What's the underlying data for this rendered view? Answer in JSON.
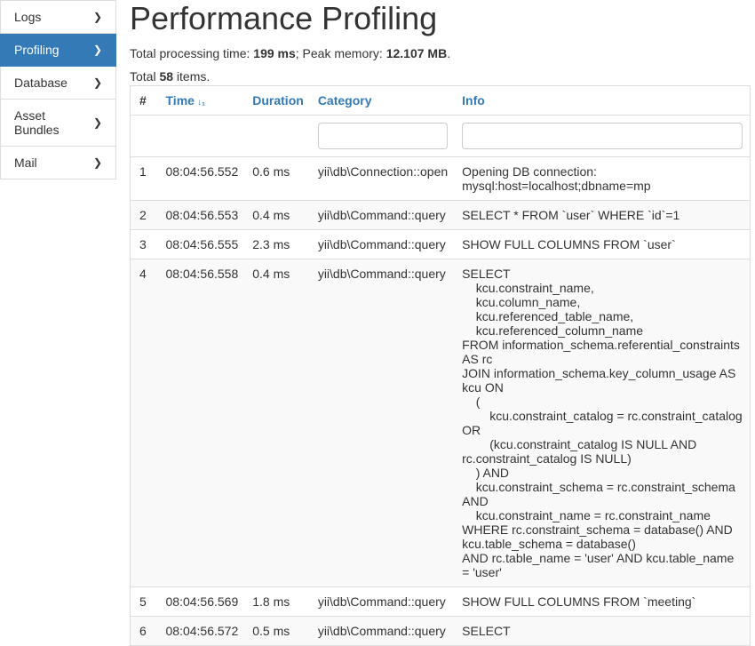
{
  "sidebar": {
    "items": [
      {
        "label": "Logs",
        "active": false
      },
      {
        "label": "Profiling",
        "active": true
      },
      {
        "label": "Database",
        "active": false
      },
      {
        "label": "Asset Bundles",
        "active": false
      },
      {
        "label": "Mail",
        "active": false
      }
    ]
  },
  "header": {
    "title": "Performance Profiling",
    "summary_prefix": "Total processing time: ",
    "processing_time": "199 ms",
    "summary_mid": "; Peak memory: ",
    "peak_memory": "12.107 MB",
    "summary_suffix": ".",
    "total_prefix": "Total ",
    "total_count": "58",
    "total_suffix": " items."
  },
  "table": {
    "headers": {
      "num": "#",
      "time": "Time",
      "duration": "Duration",
      "category": "Category",
      "info": "Info"
    },
    "rows": [
      {
        "num": "1",
        "time": "08:04:56.552",
        "duration": "0.6 ms",
        "category": "yii\\db\\Connection::open",
        "info": "Opening DB connection: mysql:host=localhost;dbname=mp"
      },
      {
        "num": "2",
        "time": "08:04:56.553",
        "duration": "0.4 ms",
        "category": "yii\\db\\Command::query",
        "info": "SELECT * FROM `user` WHERE `id`=1"
      },
      {
        "num": "3",
        "time": "08:04:56.555",
        "duration": "2.3 ms",
        "category": "yii\\db\\Command::query",
        "info": "SHOW FULL COLUMNS FROM `user`"
      },
      {
        "num": "4",
        "time": "08:04:56.558",
        "duration": "0.4 ms",
        "category": "yii\\db\\Command::query",
        "info": "SELECT\n    kcu.constraint_name,\n    kcu.column_name,\n    kcu.referenced_table_name,\n    kcu.referenced_column_name\nFROM information_schema.referential_constraints AS rc\nJOIN information_schema.key_column_usage AS kcu ON\n    (\n        kcu.constraint_catalog = rc.constraint_catalog OR\n        (kcu.constraint_catalog IS NULL AND rc.constraint_catalog IS NULL)\n    ) AND\n    kcu.constraint_schema = rc.constraint_schema AND\n    kcu.constraint_name = rc.constraint_name\nWHERE rc.constraint_schema = database() AND kcu.table_schema = database()\nAND rc.table_name = 'user' AND kcu.table_name = 'user'"
      },
      {
        "num": "5",
        "time": "08:04:56.569",
        "duration": "1.8 ms",
        "category": "yii\\db\\Command::query",
        "info": "SHOW FULL COLUMNS FROM `meeting`"
      },
      {
        "num": "6",
        "time": "08:04:56.572",
        "duration": "0.5 ms",
        "category": "yii\\db\\Command::query",
        "info": "SELECT"
      }
    ]
  }
}
